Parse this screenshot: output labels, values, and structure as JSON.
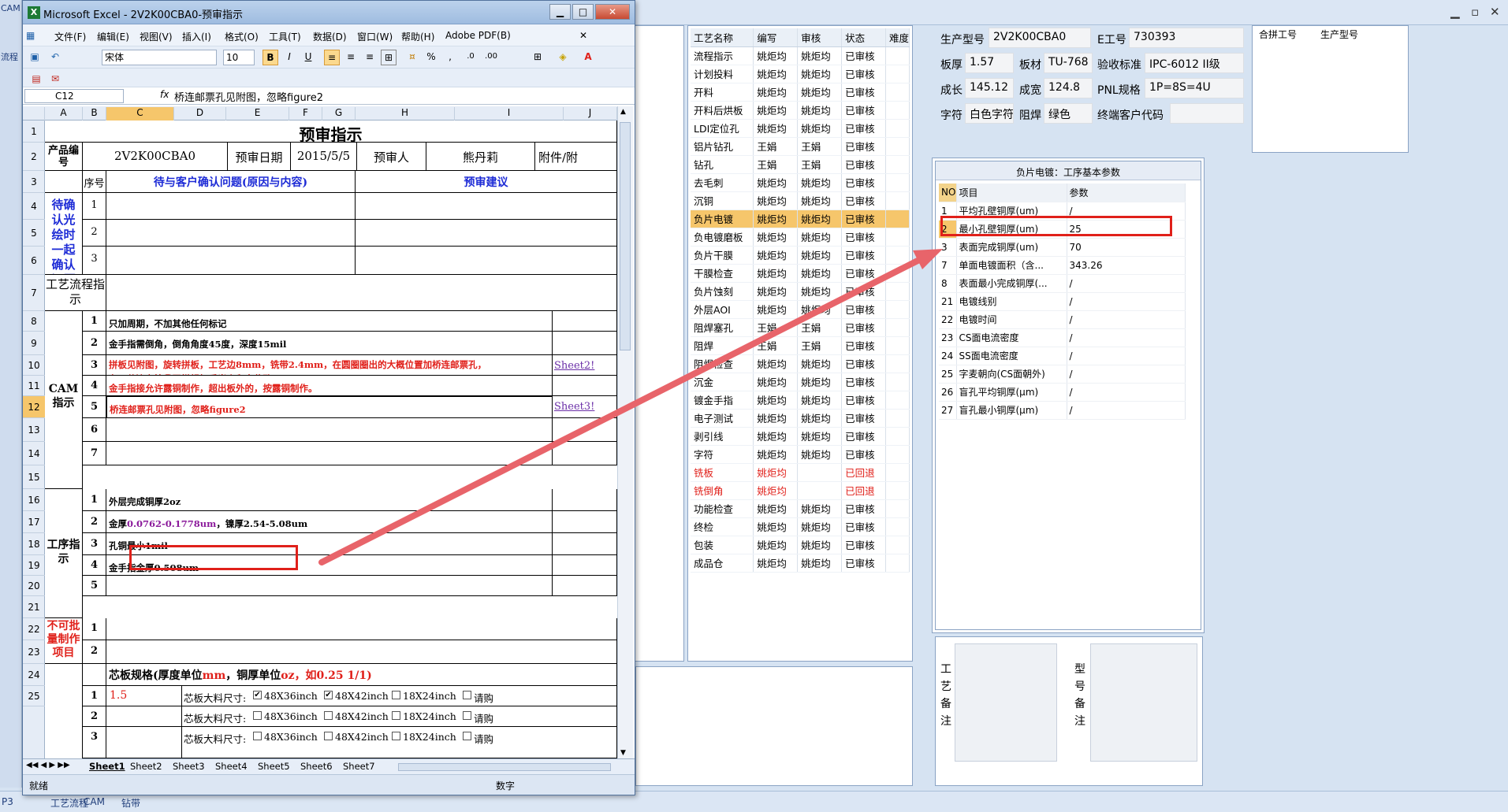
{
  "background": {
    "left_strip": [
      "CAM",
      "流程"
    ],
    "bottom_tabs": [
      "P3",
      "工艺流程",
      "CAM",
      "钻带"
    ],
    "process_table": {
      "headers": [
        "工艺名称",
        "编写",
        "审核",
        "状态",
        "难度"
      ],
      "rows": [
        [
          "流程指示",
          "姚炬均",
          "姚炬均",
          "已审核"
        ],
        [
          "计划投料",
          "姚炬均",
          "姚炬均",
          "已审核"
        ],
        [
          "开料",
          "姚炬均",
          "姚炬均",
          "已审核"
        ],
        [
          "开料后烘板",
          "姚炬均",
          "姚炬均",
          "已审核"
        ],
        [
          "LDI定位孔",
          "姚炬均",
          "姚炬均",
          "已审核"
        ],
        [
          "铝片钻孔",
          "王娟",
          "王娟",
          "已审核"
        ],
        [
          "钻孔",
          "王娟",
          "王娟",
          "已审核"
        ],
        [
          "去毛刺",
          "姚炬均",
          "姚炬均",
          "已审核"
        ],
        [
          "沉铜",
          "姚炬均",
          "姚炬均",
          "已审核"
        ],
        [
          "负片电镀",
          "姚炬均",
          "姚炬均",
          "已审核"
        ],
        [
          "负电镀磨板",
          "姚炬均",
          "姚炬均",
          "已审核"
        ],
        [
          "负片干膜",
          "姚炬均",
          "姚炬均",
          "已审核"
        ],
        [
          "干膜检查",
          "姚炬均",
          "姚炬均",
          "已审核"
        ],
        [
          "负片蚀刻",
          "姚炬均",
          "姚炬均",
          "已审核"
        ],
        [
          "外层AOI",
          "姚炬均",
          "姚炬均",
          "已审核"
        ],
        [
          "阻焊塞孔",
          "王娟",
          "王娟",
          "已审核"
        ],
        [
          "阻焊",
          "王娟",
          "王娟",
          "已审核"
        ],
        [
          "阻焊检查",
          "姚炬均",
          "姚炬均",
          "已审核"
        ],
        [
          "沉金",
          "姚炬均",
          "姚炬均",
          "已审核"
        ],
        [
          "镀金手指",
          "姚炬均",
          "姚炬均",
          "已审核"
        ],
        [
          "电子测试",
          "姚炬均",
          "姚炬均",
          "已审核"
        ],
        [
          "剥引线",
          "姚炬均",
          "姚炬均",
          "已审核"
        ],
        [
          "字符",
          "姚炬均",
          "姚炬均",
          "已审核"
        ],
        [
          "铣板",
          "姚炬均",
          "",
          "已回退"
        ],
        [
          "铣倒角",
          "姚炬均",
          "",
          "已回退"
        ],
        [
          "功能检查",
          "姚炬均",
          "姚炬均",
          "已审核"
        ],
        [
          "终检",
          "姚炬均",
          "姚炬均",
          "已审核"
        ],
        [
          "包装",
          "姚炬均",
          "姚炬均",
          "已审核"
        ],
        [
          "成品仓",
          "姚炬均",
          "姚炬均",
          "已审核"
        ]
      ]
    },
    "info": {
      "model_label": "生产型号",
      "model_value": "2V2K00CBA0",
      "eno_label": "E工号",
      "eno_value": "730393",
      "thick_label": "板厚",
      "thick_value": "1.57",
      "material_label": "板材",
      "material_value": "TU-768",
      "standard_label": "验收标准",
      "standard_value": "IPC-6012 II级",
      "length_label": "成长",
      "length_value": "145.12",
      "width_label": "成宽",
      "width_value": "124.8",
      "pnl_label": "PNL规格",
      "pnl_value": "1P=8S=4U",
      "char_label": "字符",
      "char_value": "白色字符",
      "mask_label": "阻焊",
      "mask_value": "绿色",
      "customer_label": "终端客户代码",
      "customer_value": ""
    },
    "merge_headers": [
      "合拼工号",
      "生产型号"
    ],
    "params": {
      "title": "负片电镀：工序基本参数",
      "headers": [
        "NO",
        "项目",
        "参数"
      ],
      "rows": [
        [
          "1",
          "平均孔壁铜厚(um)",
          "/"
        ],
        [
          "2",
          "最小孔壁铜厚(um)",
          "25"
        ],
        [
          "3",
          "表面完成铜厚(um)",
          "70"
        ],
        [
          "7",
          "单面电镀面积（含...",
          "343.26"
        ],
        [
          "8",
          "表面最小完成铜厚(...",
          "/"
        ],
        [
          "21",
          "电镀线别",
          "/"
        ],
        [
          "22",
          "电镀时间",
          "/"
        ],
        [
          "23",
          "CS面电流密度",
          "/"
        ],
        [
          "24",
          "SS面电流密度",
          "/"
        ],
        [
          "25",
          "字麦朝向(CS面朝外)",
          "/"
        ],
        [
          "26",
          "盲孔平均铜厚(μm)",
          "/"
        ],
        [
          "27",
          "盲孔最小铜厚(μm)",
          "/"
        ]
      ]
    },
    "remarks": {
      "process": "工艺备注",
      "model": "型号备注"
    }
  },
  "excel": {
    "title": "Microsoft Excel - 2V2K00CBA0-预审指示",
    "menu": [
      "文件(F)",
      "编辑(E)",
      "视图(V)",
      "插入(I)",
      "格式(O)",
      "工具(T)",
      "数据(D)",
      "窗口(W)",
      "帮助(H)",
      "Adobe PDF(B)"
    ],
    "font_name": "宋体",
    "font_size": "10",
    "name_box": "C12",
    "formula": "桥连邮票孔见附图，忽略figure2",
    "columns": [
      "A",
      "B",
      "C",
      "D",
      "E",
      "F",
      "G",
      "H",
      "I",
      "J"
    ],
    "rows": [
      "1",
      "2",
      "3",
      "4",
      "5",
      "6",
      "7",
      "8",
      "9",
      "10",
      "11",
      "12",
      "13",
      "14",
      "15",
      "16",
      "17",
      "18",
      "19",
      "20",
      "21",
      "22",
      "23",
      "24",
      "25"
    ],
    "sheet": {
      "title": "预审指示",
      "product_label": "产品编号",
      "product_value": "2V2K00CBA0",
      "date_label": "预审日期",
      "date_value": "2015/5/5",
      "person_label": "预审人",
      "person_value": "熊丹莉",
      "attach_label": "附件/附",
      "seq_label": "序号",
      "question_header": "待与客户确认问题(原因与内容)",
      "suggest_header": "预审建议",
      "confirm_label": "待确认光绘时一起确认问题",
      "q_nums": [
        "1",
        "2",
        "3"
      ],
      "flow_label": "工艺流程指示",
      "cam_label": "CAM指示",
      "cam_items": [
        {
          "n": "1",
          "text": "只加周期，不加其他任何标记"
        },
        {
          "n": "2",
          "text": "金手指需倒角，倒角角度45度，深度15mil"
        },
        {
          "n": "3",
          "text1": "拼板见附图，旋转拼板，工艺边8mm，铣带2.4mm，在圆圈圈出的大概位置加桥连邮票孔，",
          "text2": "在工艺边上按我司常规加反光点和定位孔",
          "link": "Sheet2!"
        },
        {
          "n": "4",
          "text": "金手指接允许露铜制作，超出板外的，按露铜制作。"
        },
        {
          "n": "5",
          "text": "桥连邮票孔见附图，忽略figure2",
          "link": "Sheet3!"
        },
        {
          "n": "6",
          "text": ""
        },
        {
          "n": "7",
          "text": ""
        }
      ],
      "proc_label": "工序指示",
      "proc_items": [
        {
          "n": "1",
          "text": "外层完成铜厚2oz"
        },
        {
          "n": "2",
          "text_a": "金厚",
          "text_b": "0.0762-0.1778um",
          "text_c": "，镍厚2.54-5.08um"
        },
        {
          "n": "3",
          "text": "孔铜最小1mil"
        },
        {
          "n": "4",
          "text": "金手指金厚0.508um"
        },
        {
          "n": "5",
          "text": ""
        }
      ],
      "nobatch_label": "不可批量制作项目",
      "nobatch_nums": [
        "1",
        "2"
      ],
      "core_title_a": "芯板规格(厚度单位",
      "core_title_b": "mm",
      "core_title_c": "，铜厚单位",
      "core_title_d": "oz",
      "core_title_e": "，如0.25 1/1)",
      "core_rows": [
        {
          "n": "1",
          "val": "1.5",
          "lbl": "芯板大料尺寸:",
          "o1": "48X36inch",
          "c1": "✔",
          "o2": "48X42inch",
          "c2": "✔",
          "o3": "18X24inch",
          "o4": "请购"
        },
        {
          "n": "2",
          "val": "",
          "lbl": "芯板大料尺寸:",
          "o1": "48X36inch",
          "c1": "",
          "o2": "48X42inch",
          "c2": "",
          "o3": "18X24inch",
          "o4": "请购"
        },
        {
          "n": "3",
          "val": "",
          "lbl": "芯板大料尺寸:",
          "o1": "48X36inch",
          "c1": "",
          "o2": "48X42inch",
          "c2": "",
          "o3": "18X24inch",
          "o4": "请购"
        }
      ]
    },
    "tabs": [
      "Sheet1",
      "Sheet2",
      "Sheet3",
      "Sheet4",
      "Sheet5",
      "Sheet6",
      "Sheet7"
    ],
    "status_left": "就绪",
    "status_mid": "数字"
  },
  "colors": {
    "accent_red": "#e0201a",
    "selection": "#f6c66b",
    "blue_text": "#1d2bd6"
  }
}
